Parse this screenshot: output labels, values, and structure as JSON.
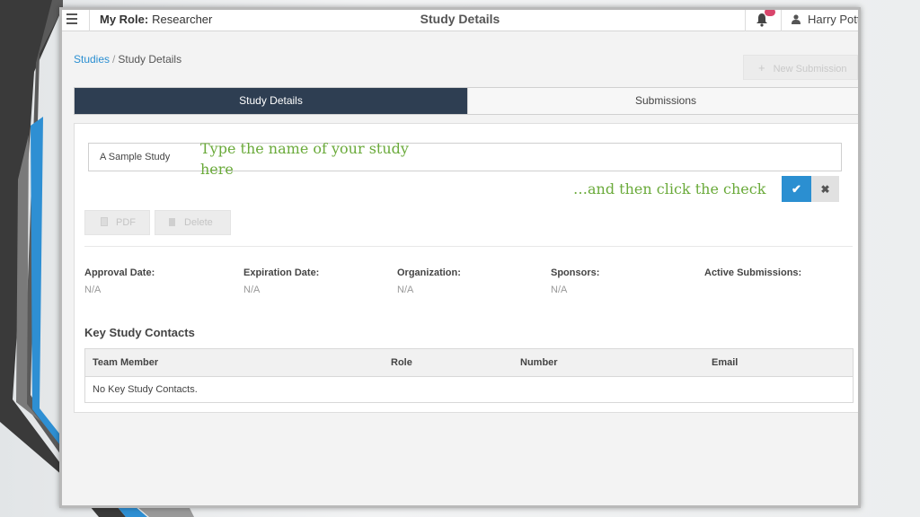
{
  "topbar": {
    "role_label": "My Role:",
    "role_value": "Researcher",
    "title": "Study Details",
    "user_name": "Harry Pott"
  },
  "breadcrumb": {
    "root": "Studies",
    "current": "Study Details"
  },
  "actions": {
    "new_submission_icon": "+",
    "new_submission_label": "New Submission",
    "pdf_label": "PDF",
    "delete_label": "Delete",
    "confirm_icon": "✔",
    "cancel_icon": "✖"
  },
  "tabs": [
    {
      "label": "Study Details",
      "active": true
    },
    {
      "label": "Submissions",
      "active": false
    }
  ],
  "form": {
    "study_name_value": "A Sample Study"
  },
  "annotations": {
    "type_name_hint": "Type the name of your study here",
    "click_check_hint": "…and then click the check"
  },
  "fields": [
    {
      "label": "Approval Date:",
      "value": "N/A"
    },
    {
      "label": "Expiration Date:",
      "value": "N/A"
    },
    {
      "label": "Organization:",
      "value": "N/A"
    },
    {
      "label": "Sponsors:",
      "value": "N/A"
    },
    {
      "label": "Active Submissions:",
      "value": ""
    }
  ],
  "contacts": {
    "title": "Key Study Contacts",
    "columns": [
      "Team Member",
      "Role",
      "Number",
      "Email"
    ],
    "empty_text": "No Key Study Contacts."
  },
  "colors": {
    "accent": "#2b8fd1",
    "header_tab": "#2e3e52",
    "annotation_green": "#6aaa3a",
    "notification_badge": "#d9456b"
  },
  "icons": {
    "menu": "hamburger-icon",
    "notifications": "bell-icon",
    "user": "user-icon",
    "pdf": "document-icon",
    "delete": "trash-icon"
  }
}
